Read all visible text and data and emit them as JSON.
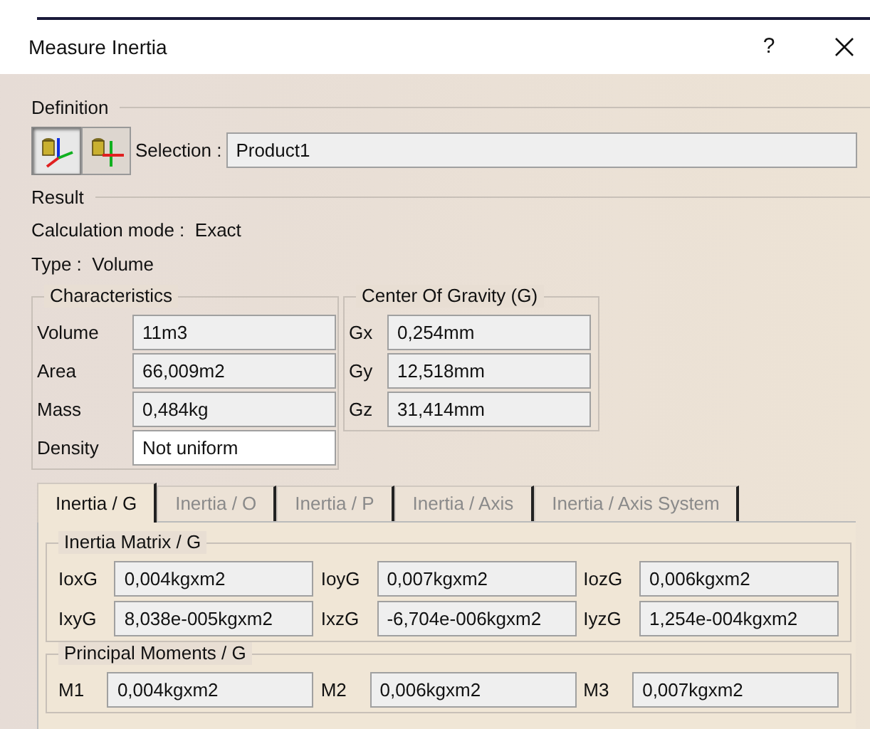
{
  "window": {
    "title": "Measure Inertia",
    "help": "?"
  },
  "definition": {
    "title": "Definition",
    "modes": [
      {
        "selected": true
      },
      {
        "selected": false
      }
    ],
    "selection_label": "Selection :",
    "selection_value": "Product1"
  },
  "result": {
    "title": "Result",
    "calculation_mode": "Calculation mode :  Exact",
    "type": "Type :  Volume",
    "characteristics": {
      "title": "Characteristics",
      "rows": [
        {
          "label": "Volume",
          "value": "11m3",
          "editable": false
        },
        {
          "label": "Area",
          "value": "66,009m2",
          "editable": false
        },
        {
          "label": "Mass",
          "value": "0,484kg",
          "editable": false
        },
        {
          "label": "Density",
          "value": "Not uniform",
          "editable": true
        }
      ]
    },
    "center_of_gravity": {
      "title": "Center Of Gravity (G)",
      "rows": [
        {
          "label": "Gx",
          "value": "0,254mm"
        },
        {
          "label": "Gy",
          "value": "12,518mm"
        },
        {
          "label": "Gz",
          "value": "31,414mm"
        }
      ]
    }
  },
  "tabs": [
    {
      "label": "Inertia / G",
      "selected": true
    },
    {
      "label": "Inertia / O",
      "selected": false
    },
    {
      "label": "Inertia / P",
      "selected": false
    },
    {
      "label": "Inertia / Axis",
      "selected": false
    },
    {
      "label": "Inertia / Axis System",
      "selected": false
    }
  ],
  "inertia_matrix": {
    "title": "Inertia Matrix / G",
    "cells": [
      {
        "label": "IoxG",
        "value": "0,004kgxm2"
      },
      {
        "label": "IoyG",
        "value": "0,007kgxm2"
      },
      {
        "label": "IozG",
        "value": "0,006kgxm2"
      },
      {
        "label": "IxyG",
        "value": "8,038e-005kgxm2"
      },
      {
        "label": "IxzG",
        "value": "-6,704e-006kgxm2"
      },
      {
        "label": "IyzG",
        "value": "1,254e-004kgxm2"
      }
    ]
  },
  "principal_moments": {
    "title": "Principal Moments / G",
    "cells": [
      {
        "label": "M1",
        "value": "0,004kgxm2"
      },
      {
        "label": "M2",
        "value": "0,006kgxm2"
      },
      {
        "label": "M3",
        "value": "0,007kgxm2"
      }
    ]
  }
}
